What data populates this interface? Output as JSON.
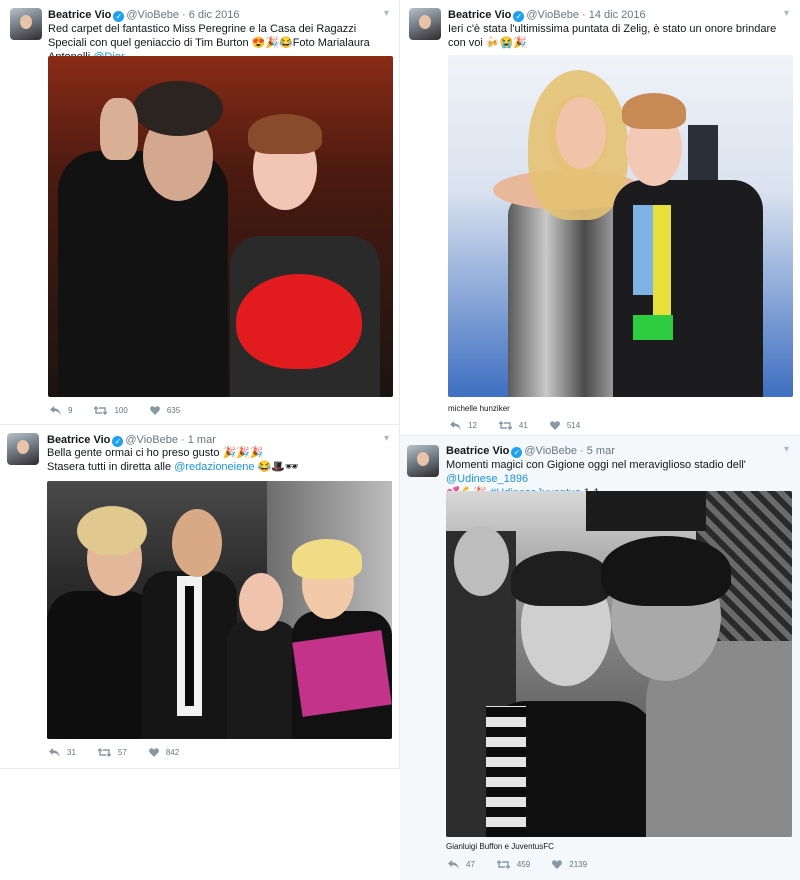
{
  "tweets": [
    {
      "name": "Beatrice Vio",
      "handle": "@VioBebe",
      "date": "6 dic 2016",
      "text_pre": "Red carpet del fantastico Miss Peregrine e la Casa dei Ragazzi Speciali con quel geniaccio di Tim Burton 😍🎉😂Foto Marialaura Antonelli ",
      "mention": "@Dior",
      "caption": "",
      "replies": "9",
      "retweets": "100",
      "likes": "635"
    },
    {
      "name": "Beatrice Vio",
      "handle": "@VioBebe",
      "date": "14 dic 2016",
      "text_pre": "Ieri c'è stata l'ultimissima puntata di Zelig, è stato un onore brindare con voi 🍻😭🎉",
      "mention": "",
      "caption": "michelle hunziker",
      "replies": "12",
      "retweets": "41",
      "likes": "514"
    },
    {
      "name": "Beatrice Vio",
      "handle": "@VioBebe",
      "date": "1 mar",
      "text_pre": "Bella gente ormai ci ho preso gusto 🎉🎉🎉",
      "text_line2_pre": "Stasera tutti in diretta alle ",
      "mention": "@redazioneiene",
      "text_post": " 😂🎩🕶",
      "caption": "",
      "replies": "31",
      "retweets": "57",
      "likes": "842"
    },
    {
      "name": "Beatrice Vio",
      "handle": "@VioBebe",
      "date": "5 mar",
      "text_pre": "Momenti magici con Gigione oggi nel meraviglioso stadio dell' ",
      "mention": "@Udinese_1896",
      "text_line2_pre": "💕💪🎉 ",
      "hashtag": "#UdineseJuventus",
      "text_post": " 1-1",
      "caption": "Gianluigi Buffon e JuventusFC",
      "replies": "47",
      "retweets": "459",
      "likes": "2139"
    }
  ],
  "icons": {
    "verified": "verified-badge-icon",
    "reply": "reply-icon",
    "retweet": "retweet-icon",
    "like": "heart-icon",
    "more": "chevron-down-icon"
  },
  "colors": {
    "link": "#1b95e0",
    "verified": "#1da1f2",
    "muted": "#657786"
  },
  "separator": "·"
}
